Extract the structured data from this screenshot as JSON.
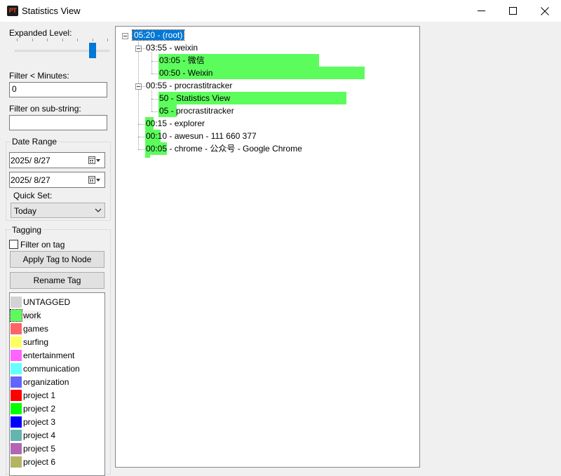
{
  "window": {
    "title": "Statistics View",
    "app_icon_text": "PT"
  },
  "controls": {
    "expanded_level_label": "Expanded Level:",
    "expanded_level_value": 5,
    "expanded_level_max": 6,
    "filter_minutes_label": "Filter < Minutes:",
    "filter_minutes_value": "0",
    "filter_substring_label": "Filter on sub-string:",
    "filter_substring_value": ""
  },
  "date_range": {
    "label": "Date Range",
    "start": "2025/  8/27",
    "end": "2025/  8/27",
    "quick_set_label": "Quick Set:",
    "quick_set_value": "Today"
  },
  "tagging": {
    "label": "Tagging",
    "filter_on_tag_label": "Filter on tag",
    "filter_on_tag_checked": false,
    "apply_button": "Apply Tag to Node",
    "rename_button": "Rename Tag",
    "tags": [
      {
        "name": "UNTAGGED",
        "color": "#d3d3d3"
      },
      {
        "name": "work",
        "color": "#5dfc5d"
      },
      {
        "name": "games",
        "color": "#ff6464"
      },
      {
        "name": "surfing",
        "color": "#ffff64"
      },
      {
        "name": "entertainment",
        "color": "#ff64ff"
      },
      {
        "name": "communication",
        "color": "#64ffff"
      },
      {
        "name": "organization",
        "color": "#6464ff"
      },
      {
        "name": "project 1",
        "color": "#ff0000"
      },
      {
        "name": "project 2",
        "color": "#00ff00"
      },
      {
        "name": "project 3",
        "color": "#0000ff"
      },
      {
        "name": "project 4",
        "color": "#64b4b4"
      },
      {
        "name": "project 5",
        "color": "#b464b4"
      },
      {
        "name": "project 6",
        "color": "#b4b464"
      }
    ]
  },
  "tree": {
    "highlight_color": "#5dfc5d",
    "nodes": [
      {
        "text": "05:20 - (root)",
        "depth": 0,
        "selected": true
      },
      {
        "text": "03:55 - weixin",
        "depth": 1
      },
      {
        "text": "03:05 - 微信",
        "depth": 2,
        "tag_fraction": 0.78
      },
      {
        "text": "00:50 - Weixin",
        "depth": 2,
        "tag_fraction": 1.0
      },
      {
        "text": "00:55 - procrastitracker",
        "depth": 1
      },
      {
        "text": "50 - Statistics View",
        "depth": 2,
        "tag_fraction": 0.91
      },
      {
        "text": "05 - procrastitracker",
        "depth": 2,
        "tag_fraction": 0.09
      },
      {
        "text": "00:15 - explorer",
        "depth": 1,
        "tag_fraction": 1.0
      },
      {
        "text": "00:10 - awesun - 111 660 377",
        "depth": 1,
        "tag_fraction": 1.0
      },
      {
        "text": "00:05 - chrome - 公众号 - Google Chrome",
        "depth": 1,
        "tag_fraction": 1.0
      }
    ]
  }
}
